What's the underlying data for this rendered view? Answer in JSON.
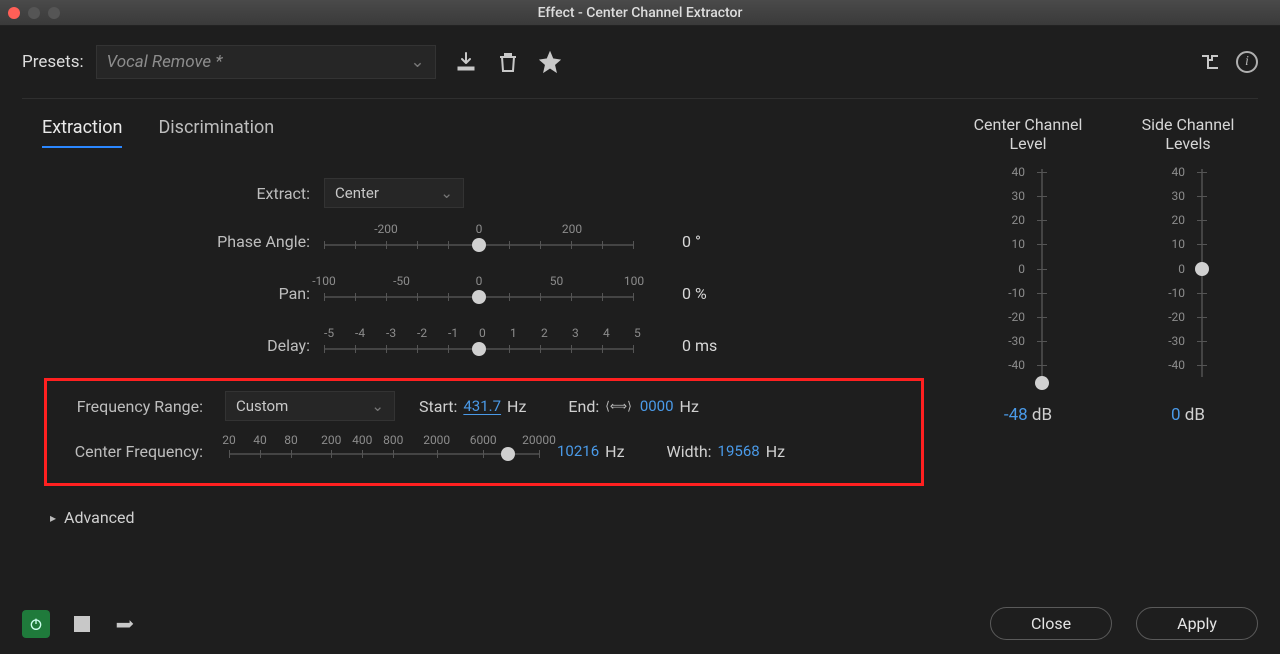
{
  "window": {
    "title": "Effect - Center Channel Extractor"
  },
  "presets": {
    "label": "Presets:",
    "selected": "Vocal Remove *"
  },
  "tabs": {
    "extraction": "Extraction",
    "discrimination": "Discrimination"
  },
  "extract": {
    "label": "Extract:",
    "value": "Center"
  },
  "phase": {
    "label": "Phase Angle:",
    "ticks": {
      "a": "-200",
      "b": "0",
      "c": "200"
    },
    "value": "0 °"
  },
  "pan": {
    "label": "Pan:",
    "ticks": {
      "a": "-100",
      "b": "-50",
      "c": "0",
      "d": "50",
      "e": "100"
    },
    "value": "0 %"
  },
  "delay": {
    "label": "Delay:",
    "ticks": {
      "a": "-5",
      "b": "-4",
      "c": "-3",
      "d": "-2",
      "e": "-1",
      "f": "0",
      "g": "1",
      "h": "2",
      "i": "3",
      "j": "4",
      "k": "5"
    },
    "value": "0 ms"
  },
  "freq": {
    "range_label": "Frequency Range:",
    "range_value": "Custom",
    "start_label": "Start:",
    "start_value": "431.7",
    "start_unit": "Hz",
    "end_label": "End:",
    "end_value": "0000",
    "end_unit": "Hz",
    "center_label": "Center Frequency:",
    "center_value": "10216",
    "center_unit": "Hz",
    "width_label": "Width:",
    "width_value": "19568",
    "width_unit": "Hz",
    "logticks": {
      "t1": "20",
      "t2": "40",
      "t3": "80",
      "t4": "200",
      "t5": "400",
      "t6": "800",
      "t7": "2000",
      "t8": "6000",
      "t9": "20000"
    }
  },
  "advanced": "Advanced",
  "levels": {
    "center": {
      "title": "Center Channel Level",
      "value": "-48",
      "unit": "dB"
    },
    "side": {
      "title": "Side Channel Levels",
      "value": "0",
      "unit": "dB"
    },
    "ticks": {
      "p40": "40",
      "p30": "30",
      "p20": "20",
      "p10": "10",
      "z": "0",
      "m10": "-10",
      "m20": "-20",
      "m30": "-30",
      "m40": "-40"
    }
  },
  "footer": {
    "close": "Close",
    "apply": "Apply"
  }
}
